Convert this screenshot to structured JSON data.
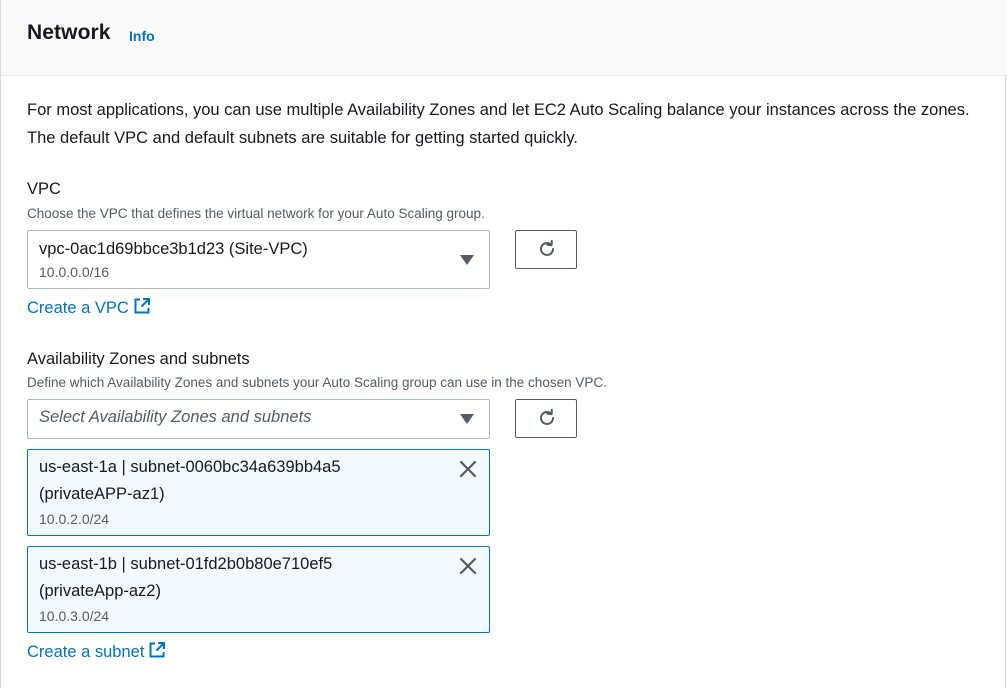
{
  "header": {
    "title": "Network",
    "info_label": "Info"
  },
  "description": "For most applications, you can use multiple Availability Zones and let EC2 Auto Scaling balance your instances across the zones. The default VPC and default subnets are suitable for getting started quickly.",
  "vpc": {
    "label": "VPC",
    "hint": "Choose the VPC that defines the virtual network for your Auto Scaling group.",
    "selected_value": "vpc-0ac1d69bbce3b1d23 (Site-VPC)",
    "selected_cidr": "10.0.0.0/16",
    "create_link": "Create a VPC"
  },
  "subnets": {
    "label": "Availability Zones and subnets",
    "hint": "Define which Availability Zones and subnets your Auto Scaling group can use in the chosen VPC.",
    "placeholder": "Select Availability Zones and subnets",
    "selected": [
      {
        "line1": "us-east-1a | subnet-0060bc34a639bb4a5",
        "line2": "(privateAPP-az1)",
        "cidr": "10.0.2.0/24"
      },
      {
        "line1": "us-east-1b | subnet-01fd2b0b80e710ef5",
        "line2": "(privateApp-az2)",
        "cidr": "10.0.3.0/24"
      }
    ],
    "create_link": "Create a subnet"
  },
  "icons": {
    "refresh": "refresh-icon",
    "external": "external-link-icon",
    "caret": "caret-down-icon",
    "close": "close-icon"
  },
  "colors": {
    "link": "#0073bb",
    "token_bg": "#f1faff",
    "token_border": "#0073bb",
    "text": "#16191f",
    "muted": "#545b64"
  }
}
